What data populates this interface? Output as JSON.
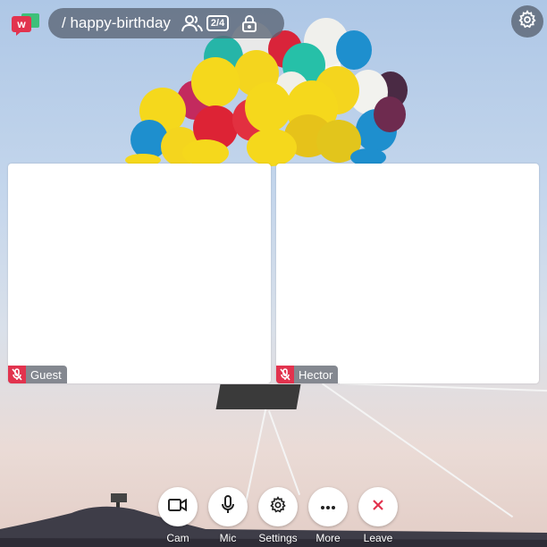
{
  "header": {
    "room_name": "/ happy-birthday",
    "participant_count": "2/4",
    "icons": [
      "logo-icon",
      "people-icon",
      "lock-icon",
      "settings-icon"
    ]
  },
  "tiles": [
    {
      "name": "Guest",
      "muted": true
    },
    {
      "name": "Hector",
      "muted": true
    }
  ],
  "controls": {
    "cam": "Cam",
    "mic": "Mic",
    "settings": "Settings",
    "more": "More",
    "leave": "Leave"
  },
  "colors": {
    "accent": "#e2334e",
    "pill_bg": "#5a6473",
    "logo_green": "#3ec07a"
  }
}
